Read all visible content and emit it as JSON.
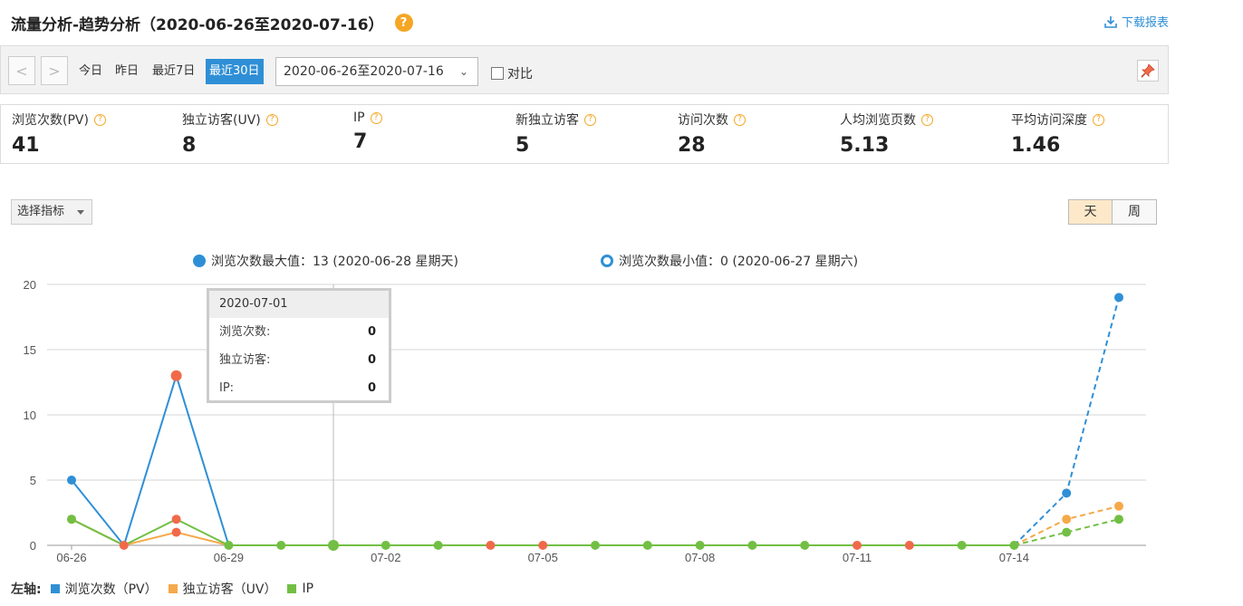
{
  "header": {
    "title": "流量分析-趋势分析（2020-06-26至2020-07-16）",
    "help": "?",
    "download_label": "下载报表"
  },
  "toolbar": {
    "prev": "<",
    "next": ">",
    "ranges": [
      "今日",
      "昨日",
      "最近7日",
      "最近30日"
    ],
    "active_range": "最近30日",
    "date_range_value": "2020-06-26至2020-07-16",
    "compare_label": "对比"
  },
  "metrics": [
    {
      "label": "浏览次数(PV)",
      "value": "41"
    },
    {
      "label": "独立访客(UV)",
      "value": "8"
    },
    {
      "label": "IP",
      "value": "7"
    },
    {
      "label": "新独立访客",
      "value": "5"
    },
    {
      "label": "访问次数",
      "value": "28"
    },
    {
      "label": "人均浏览页数",
      "value": "5.13"
    },
    {
      "label": "平均访问深度",
      "value": "1.46"
    }
  ],
  "controls": {
    "select_indicator": "选择指标",
    "period_day": "天",
    "period_week": "周"
  },
  "chart_legend": {
    "max_label": "浏览次数最大值：13 (2020-06-28 星期天)",
    "min_label": "浏览次数最小值：0 (2020-06-27 星期六)"
  },
  "tooltip": {
    "date": "2020-07-01",
    "rows": [
      {
        "label": "浏览次数:",
        "value": "0"
      },
      {
        "label": "独立访客:",
        "value": "0"
      },
      {
        "label": "IP:",
        "value": "0"
      }
    ]
  },
  "bottom_legend": {
    "axis_label": "左轴:",
    "items": [
      {
        "label": "浏览次数（PV）",
        "color": "#2f8fd6"
      },
      {
        "label": "独立访客（UV）",
        "color": "#f5a94a"
      },
      {
        "label": "IP",
        "color": "#72bf44"
      }
    ]
  },
  "colors": {
    "pv": "#2f8fd6",
    "uv": "#f5a94a",
    "ip": "#72bf44",
    "point_zero": "#f06a4a"
  },
  "chart_data": {
    "type": "line",
    "x": [
      "06-26",
      "06-27",
      "06-28",
      "06-29",
      "06-30",
      "07-01",
      "07-02",
      "07-03",
      "07-04",
      "07-05",
      "07-06",
      "07-07",
      "07-08",
      "07-09",
      "07-10",
      "07-11",
      "07-12",
      "07-13",
      "07-14",
      "07-15",
      "07-16"
    ],
    "x_tick_labels": [
      "06-26",
      "06-29",
      "07-02",
      "07-05",
      "07-08",
      "07-11",
      "07-14"
    ],
    "ylim": [
      0,
      20
    ],
    "y_ticks": [
      "0",
      "5",
      "10",
      "15",
      "20"
    ],
    "series": [
      {
        "name": "浏览次数（PV）",
        "values": [
          5,
          0,
          13,
          0,
          0,
          0,
          0,
          0,
          0,
          0,
          0,
          0,
          0,
          0,
          0,
          0,
          0,
          0,
          0,
          4,
          19
        ]
      },
      {
        "name": "独立访客（UV）",
        "values": [
          2,
          0,
          1,
          0,
          0,
          0,
          0,
          0,
          0,
          0,
          0,
          0,
          0,
          0,
          0,
          0,
          0,
          0,
          0,
          2,
          3
        ]
      },
      {
        "name": "IP",
        "values": [
          2,
          0,
          2,
          0,
          0,
          0,
          0,
          0,
          0,
          0,
          0,
          0,
          0,
          0,
          0,
          0,
          0,
          0,
          0,
          1,
          2
        ]
      }
    ],
    "forecast_from_index": 19,
    "grid": true
  }
}
